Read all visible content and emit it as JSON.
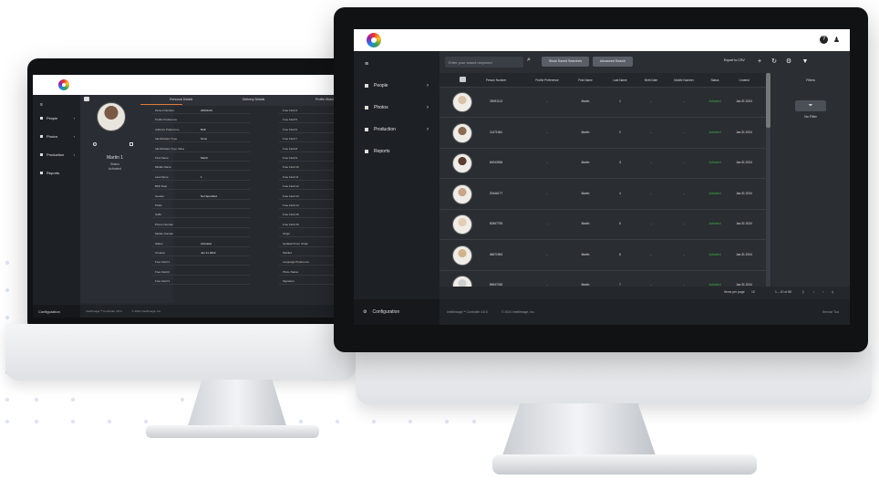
{
  "colors": {
    "accent": "#e07b39",
    "status_green": "#3cb043",
    "sidebar": "#1d2025",
    "content": "#26292e"
  },
  "back_app": {
    "sidebar": {
      "menu_icon": "hamburger-icon",
      "items": [
        {
          "label": "People",
          "icon": "people-icon"
        },
        {
          "label": "Photos",
          "icon": "photos-icon"
        },
        {
          "label": "Production",
          "icon": "production-icon"
        },
        {
          "label": "Reports",
          "icon": "reports-icon"
        }
      ],
      "configuration": "Configuration"
    },
    "person": {
      "name": "Martin 1",
      "status_label": "Status",
      "status_value": "Activated"
    },
    "tabs": [
      "Personal Details",
      "Delivery Details",
      "Profile History"
    ],
    "fields": [
      {
        "label": "Person Number",
        "value": "26091113"
      },
      {
        "label": "Profile Preference",
        "value": ""
      },
      {
        "label": "Address Preference",
        "value": "Both"
      },
      {
        "label": "Identification Type",
        "value": "None"
      },
      {
        "label": "Identification Type Value",
        "value": ""
      },
      {
        "label": "First Name",
        "value": "Martin"
      },
      {
        "label": "Middle Name",
        "value": ""
      },
      {
        "label": "Last Name",
        "value": "1"
      },
      {
        "label": "Birth Date",
        "value": ""
      },
      {
        "label": "Gender",
        "value": "Not Specified"
      },
      {
        "label": "Prefix",
        "value": ""
      },
      {
        "label": "Suffix",
        "value": ""
      },
      {
        "label": "Phone Number",
        "value": ""
      },
      {
        "label": "Mobile Number",
        "value": ""
      },
      {
        "label": "Status",
        "value": "Activated"
      },
      {
        "label": "Created",
        "value": "Jan 31 2024"
      },
      {
        "label": "Free Field 1",
        "value": ""
      },
      {
        "label": "Free Field 2",
        "value": ""
      },
      {
        "label": "Free Field 3",
        "value": ""
      }
    ],
    "fields_right": [
      "Free Field 4",
      "Free Field 5",
      "Free Field 6",
      "Free Field 7",
      "Free Field 8",
      "Free Field 9",
      "Free Field 10",
      "Free Field 11",
      "Free Field 12",
      "Free Field 13",
      "Free Field 14",
      "Free Field 15",
      "Free Field 16",
      "Origin",
      "Updated From Origin",
      "Mobiles",
      "Language Preference",
      "Photo Status",
      "Signature"
    ],
    "footer": [
      "IntelliImage™ Controller 4.8.0",
      "© 2024 IntelliImage, Inc."
    ]
  },
  "front_app": {
    "topbar": {
      "help_icon": "help-icon",
      "user_icon": "user-icon"
    },
    "sidebar": {
      "menu_icon": "hamburger-icon",
      "items": [
        {
          "label": "People",
          "icon": "people-icon"
        },
        {
          "label": "Photos",
          "icon": "photos-icon"
        },
        {
          "label": "Production",
          "icon": "production-icon"
        },
        {
          "label": "Reports",
          "icon": "reports-icon"
        }
      ],
      "configuration": "Configuration"
    },
    "toolbar": {
      "search_placeholder": "Enter your search keyword",
      "saved_searches": "Show Saved Searches",
      "advanced_search": "Advanced Search",
      "export": "Export to CSV",
      "icons": [
        "add-icon",
        "refresh-icon",
        "settings-icon",
        "filter-icon"
      ]
    },
    "table": {
      "headers": [
        "Person Number",
        "Profile Preference",
        "First Name",
        "Last Name",
        "Birth Date",
        "Mobile Number",
        "Status",
        "Created"
      ],
      "rows": [
        {
          "person": "25091113",
          "pref": "-",
          "first": "Martin",
          "last": "1",
          "birth": "-",
          "mobile": "-",
          "status": "Activated",
          "created": "Jan 31 2024"
        },
        {
          "person": "11471364",
          "pref": "-",
          "first": "Martin",
          "last": "2",
          "birth": "-",
          "mobile": "-",
          "status": "Activated",
          "created": "Jan 31 2024"
        },
        {
          "person": "60043936",
          "pref": "-",
          "first": "Martin",
          "last": "3",
          "birth": "-",
          "mobile": "-",
          "status": "Activated",
          "created": "Jan 31 2024"
        },
        {
          "person": "20446177",
          "pref": "-",
          "first": "Martin",
          "last": "4",
          "birth": "-",
          "mobile": "-",
          "status": "Activated",
          "created": "Jan 31 2024"
        },
        {
          "person": "60567795",
          "pref": "-",
          "first": "Martin",
          "last": "5",
          "birth": "-",
          "mobile": "-",
          "status": "Activated",
          "created": "Jan 31 2024"
        },
        {
          "person": "46671963",
          "pref": "-",
          "first": "Martin",
          "last": "6",
          "birth": "-",
          "mobile": "-",
          "status": "Activated",
          "created": "Jan 31 2024"
        },
        {
          "person": "89647038",
          "pref": "-",
          "first": "Martin",
          "last": "7",
          "birth": "-",
          "mobile": "-",
          "status": "Activated",
          "created": "Jan 31 2024"
        }
      ]
    },
    "filters": {
      "title": "Filters",
      "no_filter": "No Filter"
    },
    "pager": {
      "items_label": "Items per page",
      "items_value": "10",
      "range": "1 – 10 of 58"
    },
    "footer": [
      "IntelliImage™ Controller 4.8.0",
      "© 2024 IntelliImage, Inc.",
      "Service Tool"
    ]
  }
}
